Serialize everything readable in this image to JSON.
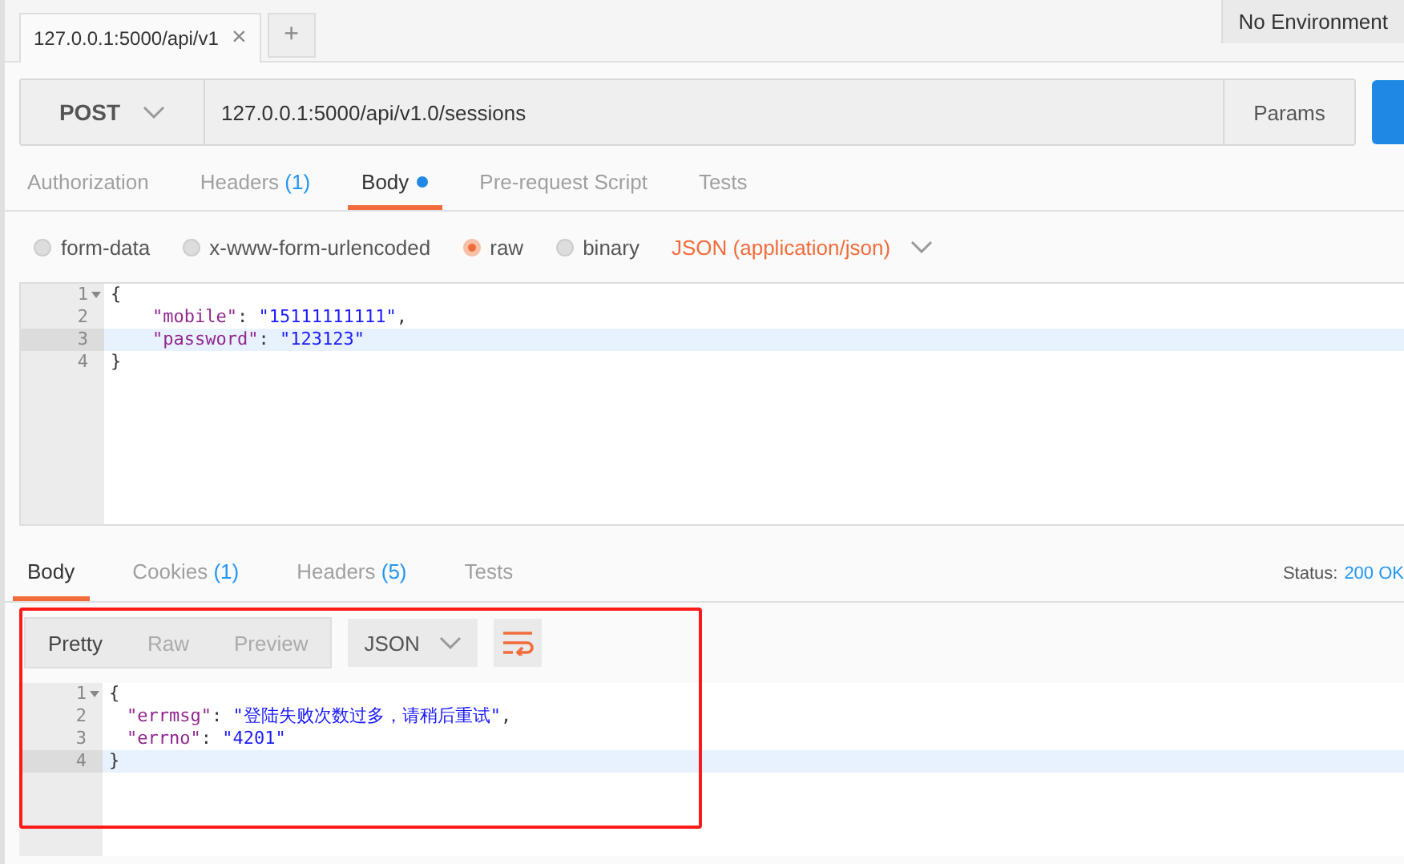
{
  "request_tabs": [
    {
      "label": "127.0.0.1:5000/api/v1",
      "selected": true,
      "close": "×"
    }
  ],
  "new_tab": "+",
  "environment": "No Environment",
  "request": {
    "method": "POST",
    "url": "127.0.0.1:5000/api/v1.0/sessions",
    "params_button": "Params"
  },
  "request_sections": [
    {
      "label": "Authorization",
      "selected": false,
      "dot": false
    },
    {
      "label": "Headers",
      "count": "(1)",
      "selected": false,
      "dot": false
    },
    {
      "label": "Body",
      "selected": true,
      "dot": true
    },
    {
      "label": "Pre-request Script",
      "selected": false,
      "dot": false
    },
    {
      "label": "Tests",
      "selected": false,
      "dot": false
    }
  ],
  "body_modes": [
    {
      "label": "form-data",
      "selected": false
    },
    {
      "label": "x-www-form-urlencoded",
      "selected": false
    },
    {
      "label": "raw",
      "selected": true
    },
    {
      "label": "binary",
      "selected": false
    }
  ],
  "content_type": "JSON (application/json)",
  "request_body": [
    {
      "number": "1",
      "fold": true,
      "current": false,
      "indent": false,
      "tokens": [
        {
          "kind": "punct",
          "text": "{"
        }
      ]
    },
    {
      "number": "2",
      "fold": false,
      "current": false,
      "indent": true,
      "tokens": [
        {
          "kind": "key",
          "text": "\"mobile\""
        },
        {
          "kind": "punct",
          "text": ": "
        },
        {
          "kind": "string",
          "text": "\"15111111111\""
        },
        {
          "kind": "punct",
          "text": ","
        }
      ]
    },
    {
      "number": "3",
      "fold": false,
      "current": true,
      "indent": true,
      "tokens": [
        {
          "kind": "key",
          "text": "\"password\""
        },
        {
          "kind": "punct",
          "text": ": "
        },
        {
          "kind": "string",
          "text": "\"123123\""
        }
      ]
    },
    {
      "number": "4",
      "fold": false,
      "current": false,
      "indent": false,
      "tokens": [
        {
          "kind": "punct",
          "text": "}"
        }
      ]
    }
  ],
  "response_sections": [
    {
      "label": "Body",
      "selected": true
    },
    {
      "label": "Cookies",
      "count": "(1)",
      "selected": false
    },
    {
      "label": "Headers",
      "count": "(5)",
      "selected": false
    },
    {
      "label": "Tests",
      "selected": false
    }
  ],
  "status": {
    "label": "Status:",
    "value": "200 OK"
  },
  "view_modes": [
    {
      "label": "Pretty",
      "selected": true
    },
    {
      "label": "Raw",
      "selected": false
    },
    {
      "label": "Preview",
      "selected": false
    }
  ],
  "format": "JSON",
  "response_body": [
    {
      "number": "1",
      "fold": true,
      "current": false,
      "indent": false,
      "tokens": [
        {
          "kind": "punct",
          "text": "{"
        }
      ]
    },
    {
      "number": "2",
      "fold": false,
      "current": false,
      "indent": true,
      "tokens": [
        {
          "kind": "key",
          "text": "\"errmsg\""
        },
        {
          "kind": "punct",
          "text": ": "
        },
        {
          "kind": "string",
          "text": "\"登陆失败次数过多，请稍后重试\""
        },
        {
          "kind": "punct",
          "text": ","
        }
      ]
    },
    {
      "number": "3",
      "fold": false,
      "current": false,
      "indent": true,
      "tokens": [
        {
          "kind": "key",
          "text": "\"errno\""
        },
        {
          "kind": "punct",
          "text": ": "
        },
        {
          "kind": "string",
          "text": "\"4201\""
        }
      ]
    },
    {
      "number": "4",
      "fold": false,
      "current": true,
      "indent": false,
      "tokens": [
        {
          "kind": "punct",
          "text": "}"
        }
      ]
    }
  ]
}
